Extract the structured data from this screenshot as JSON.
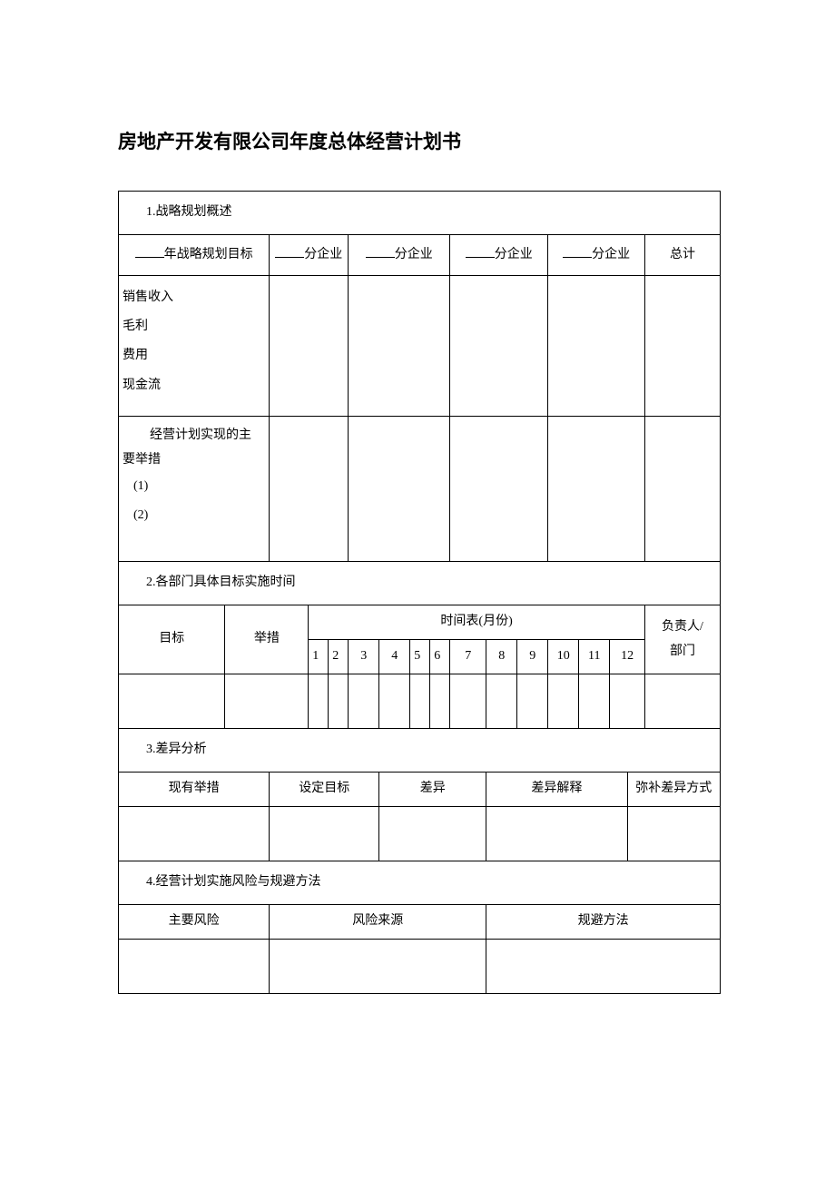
{
  "title": "房地产开发有限公司年度总体经营计划书",
  "section1": {
    "header": "1.战略规划概述",
    "col_year_label_suffix": "年战略规划目标",
    "subcol_label": "分企业",
    "total_label": "总计",
    "metrics": {
      "sales": "销售收入",
      "gross": "毛利",
      "expense": "费用",
      "cashflow": "现金流"
    },
    "measures_header_line1": "经营计划实现的主",
    "measures_header_line2": "要举措",
    "measures_items": {
      "i1": "(1)",
      "i2": "(2)"
    }
  },
  "section2": {
    "header": "2.各部门具体目标实施时间",
    "col_target": "目标",
    "col_measure": "举措",
    "timetable_label": "时间表(月份)",
    "months": {
      "m1": "1",
      "m2": "2",
      "m3": "3",
      "m4": "4",
      "m5": "5",
      "m6": "6",
      "m7": "7",
      "m8": "8",
      "m9": "9",
      "m10": "10",
      "m11": "11",
      "m12": "12"
    },
    "responsible_line1": "负责人/",
    "responsible_line2": "部门"
  },
  "section3": {
    "header": "3.差异分析",
    "cols": {
      "existing": "现有举措",
      "target": "设定目标",
      "diff": "差异",
      "explain": "差异解释",
      "remedy": "弥补差异方式"
    }
  },
  "section4": {
    "header": "4.经营计划实施风险与规避方法",
    "cols": {
      "risk": "主要风险",
      "source": "风险来源",
      "avoid": "规避方法"
    }
  }
}
